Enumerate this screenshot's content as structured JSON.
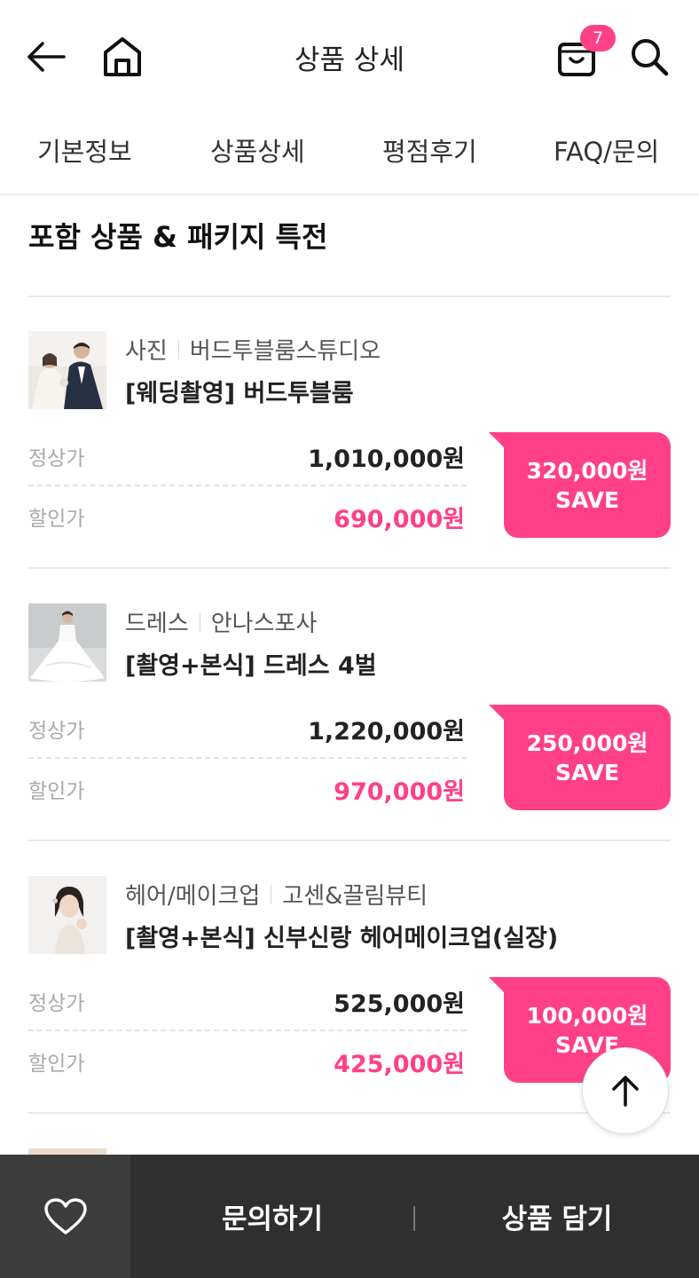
{
  "header": {
    "title": "상품 상세",
    "cart_count": "7",
    "icons": [
      "back-arrow-icon",
      "home-icon",
      "shopping-bag-icon",
      "search-icon"
    ]
  },
  "tabs": [
    {
      "label": "기본정보"
    },
    {
      "label": "상품상세"
    },
    {
      "label": "평점후기"
    },
    {
      "label": "FAQ/문의"
    }
  ],
  "section": {
    "title": "포함 상품 & 패키지 특전"
  },
  "items": [
    {
      "category": "사진",
      "vendor": "버드투블룸스튜디오",
      "title": "[웨딩촬영] 버드투블룸",
      "orig_label": "정상가",
      "orig_price": "1,010,000원",
      "sale_label": "할인가",
      "sale_price": "690,000원",
      "save_amount": "320,000원",
      "save_label": "SAVE"
    },
    {
      "category": "드레스",
      "vendor": "안나스포사",
      "title": "[촬영+본식] 드레스 4벌",
      "orig_label": "정상가",
      "orig_price": "1,220,000원",
      "sale_label": "할인가",
      "sale_price": "970,000원",
      "save_amount": "250,000원",
      "save_label": "SAVE"
    },
    {
      "category": "헤어/메이크업",
      "vendor": "고센&끌림뷰티",
      "title": "[촬영+본식] 신부신랑 헤어메이크업(실장)",
      "orig_label": "정상가",
      "orig_price": "525,000원",
      "sale_label": "할인가",
      "sale_price": "425,000원",
      "save_amount": "100,000원",
      "save_label": "SAVE"
    }
  ],
  "bottom_bar": {
    "inquiry": "문의하기",
    "add_to_cart": "상품 담기"
  },
  "colors": {
    "accent": "#ff4088",
    "bottom_bar": "#2f2f2f",
    "like_bg": "#3c3c3c"
  }
}
